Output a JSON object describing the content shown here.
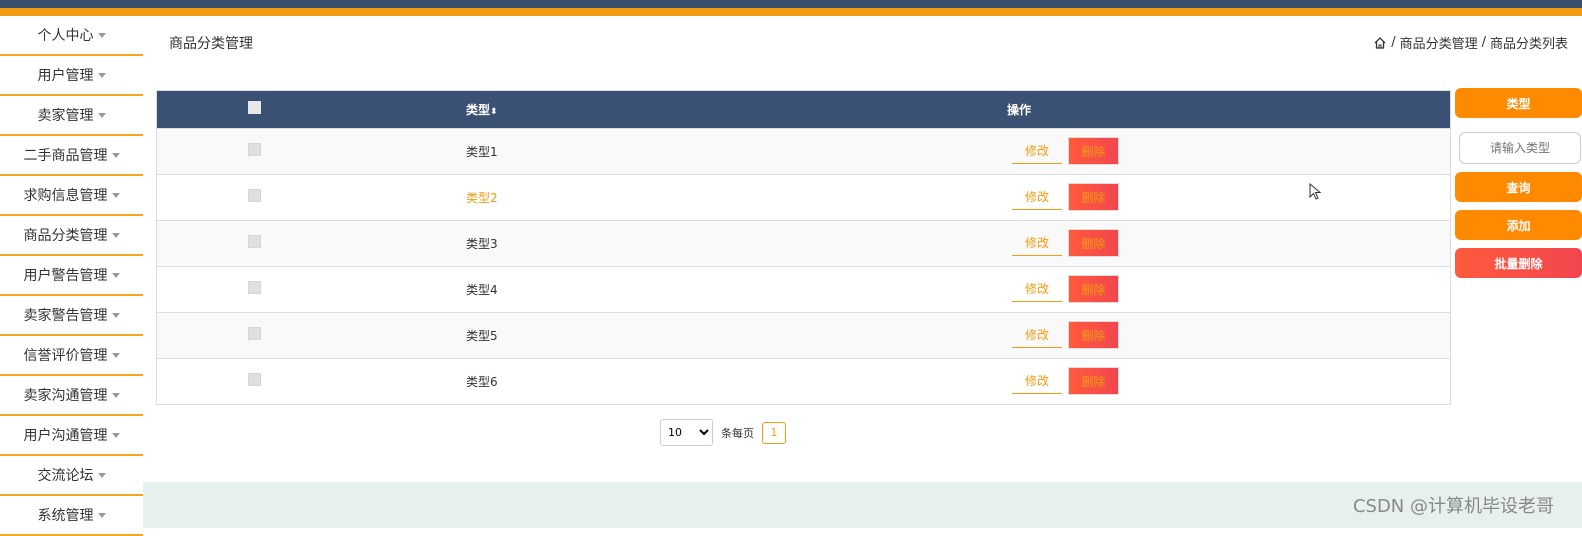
{
  "colors": {
    "accent": "#f39c12",
    "header": "#3a5174",
    "danger": "#f2464f"
  },
  "sidebar": {
    "items": [
      {
        "label": "个人中心"
      },
      {
        "label": "用户管理"
      },
      {
        "label": "卖家管理"
      },
      {
        "label": "二手商品管理"
      },
      {
        "label": "求购信息管理"
      },
      {
        "label": "商品分类管理"
      },
      {
        "label": "用户警告管理"
      },
      {
        "label": "卖家警告管理"
      },
      {
        "label": "信誉评价管理"
      },
      {
        "label": "卖家沟通管理"
      },
      {
        "label": "用户沟通管理"
      },
      {
        "label": "交流论坛"
      },
      {
        "label": "系统管理"
      }
    ]
  },
  "header": {
    "title": "商品分类管理",
    "breadcrumb": {
      "sep": "/",
      "level1": "商品分类管理",
      "level2": "商品分类列表"
    }
  },
  "table": {
    "columns": {
      "type": "类型",
      "actions": "操作"
    },
    "edit_label": "修改",
    "delete_label": "删除",
    "rows": [
      {
        "type": "类型1"
      },
      {
        "type": "类型2"
      },
      {
        "type": "类型3"
      },
      {
        "type": "类型4"
      },
      {
        "type": "类型5"
      },
      {
        "type": "类型6"
      }
    ]
  },
  "pagination": {
    "page_size": "10",
    "per_page_label": "条每页",
    "current_page": "1"
  },
  "search": {
    "type_label": "类型",
    "placeholder": "请输入类型",
    "query_label": "查询",
    "add_label": "添加",
    "batch_delete_label": "批量删除"
  },
  "watermark": "CSDN @计算机毕设老哥"
}
